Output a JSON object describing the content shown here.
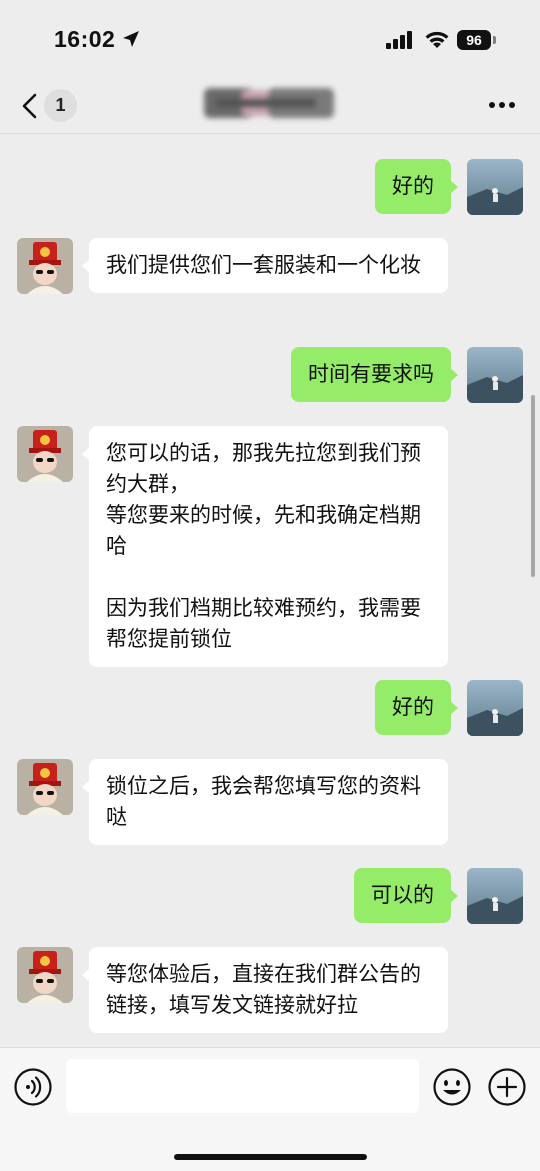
{
  "status_bar": {
    "time": "16:02",
    "battery": "96"
  },
  "nav": {
    "unread_count": "1"
  },
  "messages": [
    {
      "from": "me",
      "text": "好的"
    },
    {
      "from": "them",
      "text": "我们提供您们一套服装和一个化妆"
    },
    {
      "from": "me",
      "text": "时间有要求吗"
    },
    {
      "from": "them",
      "text": "您可以的话，那我先拉您到我们预约大群，\n等您要来的时候，先和我确定档期哈\n\n因为我们档期比较难预约，我需要帮您提前锁位"
    },
    {
      "from": "me",
      "text": "好的"
    },
    {
      "from": "them",
      "text": "锁位之后，我会帮您填写您的资料哒"
    },
    {
      "from": "me",
      "text": "可以的"
    },
    {
      "from": "them",
      "text": "等您体验后，直接在我们群公告的链接，填写发文链接就好拉"
    }
  ],
  "input": {
    "value": ""
  },
  "icons": {
    "back": "chevron-left-icon",
    "more": "more-dots-icon",
    "voice": "voice-icon",
    "emoji": "emoji-icon",
    "plus": "plus-icon"
  },
  "colors": {
    "my_bubble": "#95ec69",
    "their_bubble": "#ffffff",
    "background": "#ededed"
  }
}
